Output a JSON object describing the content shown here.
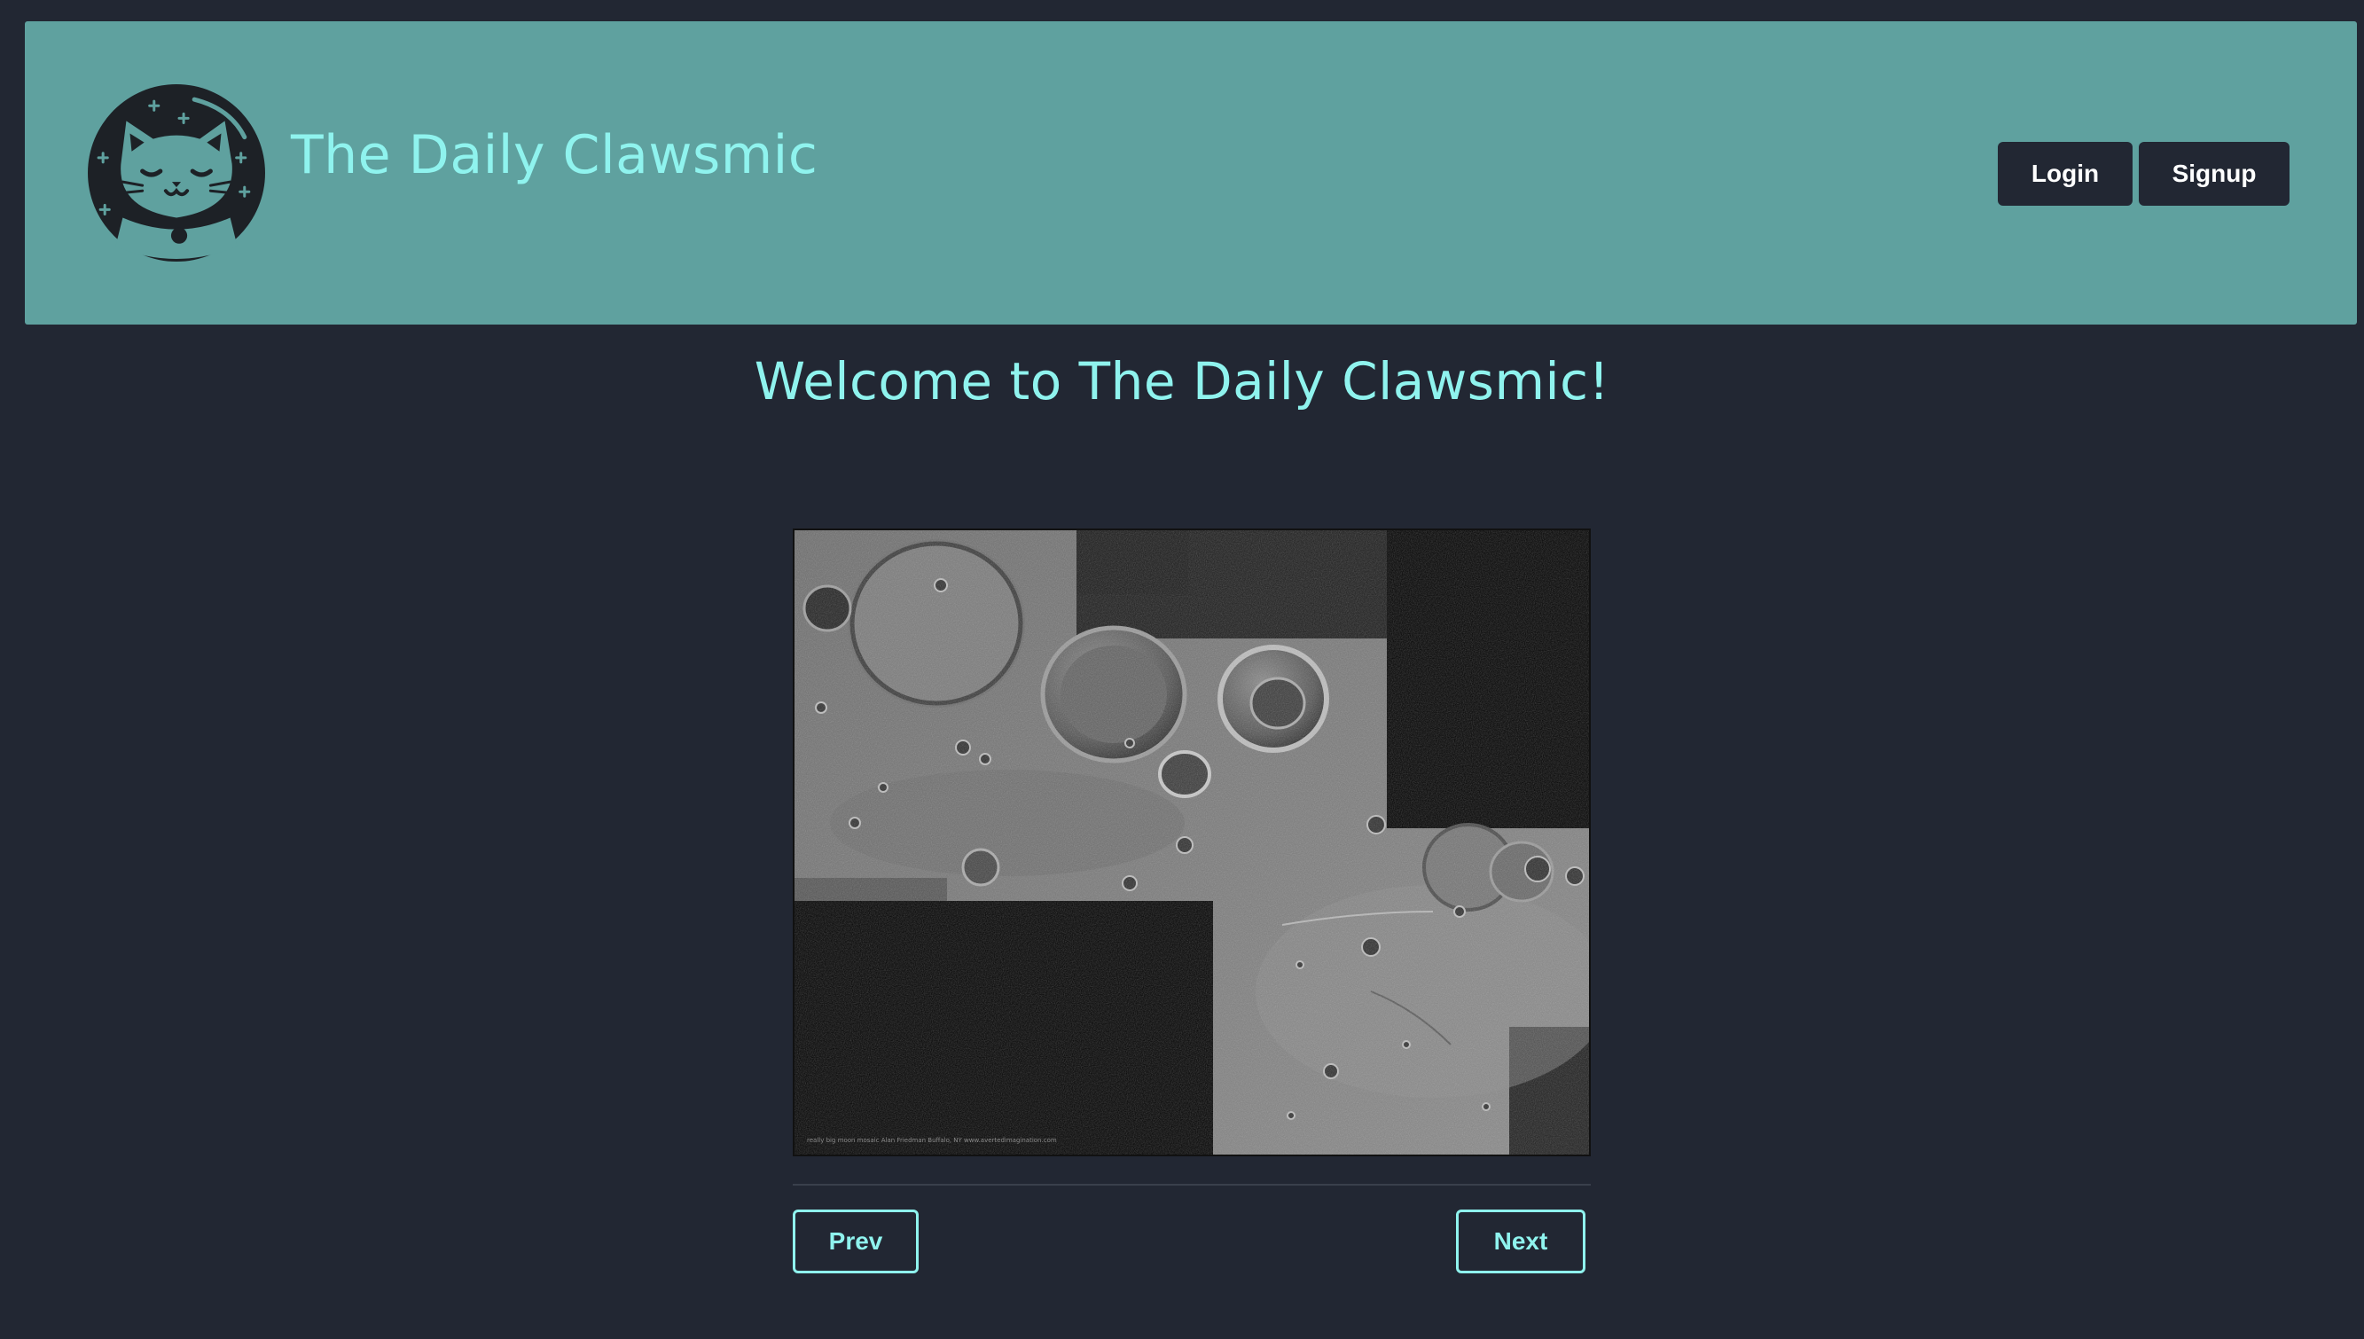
{
  "header": {
    "site_title": "The Daily Clawsmic",
    "login_label": "Login",
    "signup_label": "Signup",
    "logo_icon": "cat-astronaut-logo-icon"
  },
  "main": {
    "welcome_heading": "Welcome to The Daily Clawsmic!",
    "image": {
      "subject": "moon-surface-mosaic-photo",
      "caption_text": "really big moon mosaic    Alan Friedman  Buffalo, NY   www.avertedimagination.com"
    },
    "prev_label": "Prev",
    "next_label": "Next"
  },
  "colors": {
    "background": "#222733",
    "header_bg": "#5fa19f",
    "accent": "#8ff3ee",
    "button_dark": "#222733"
  }
}
